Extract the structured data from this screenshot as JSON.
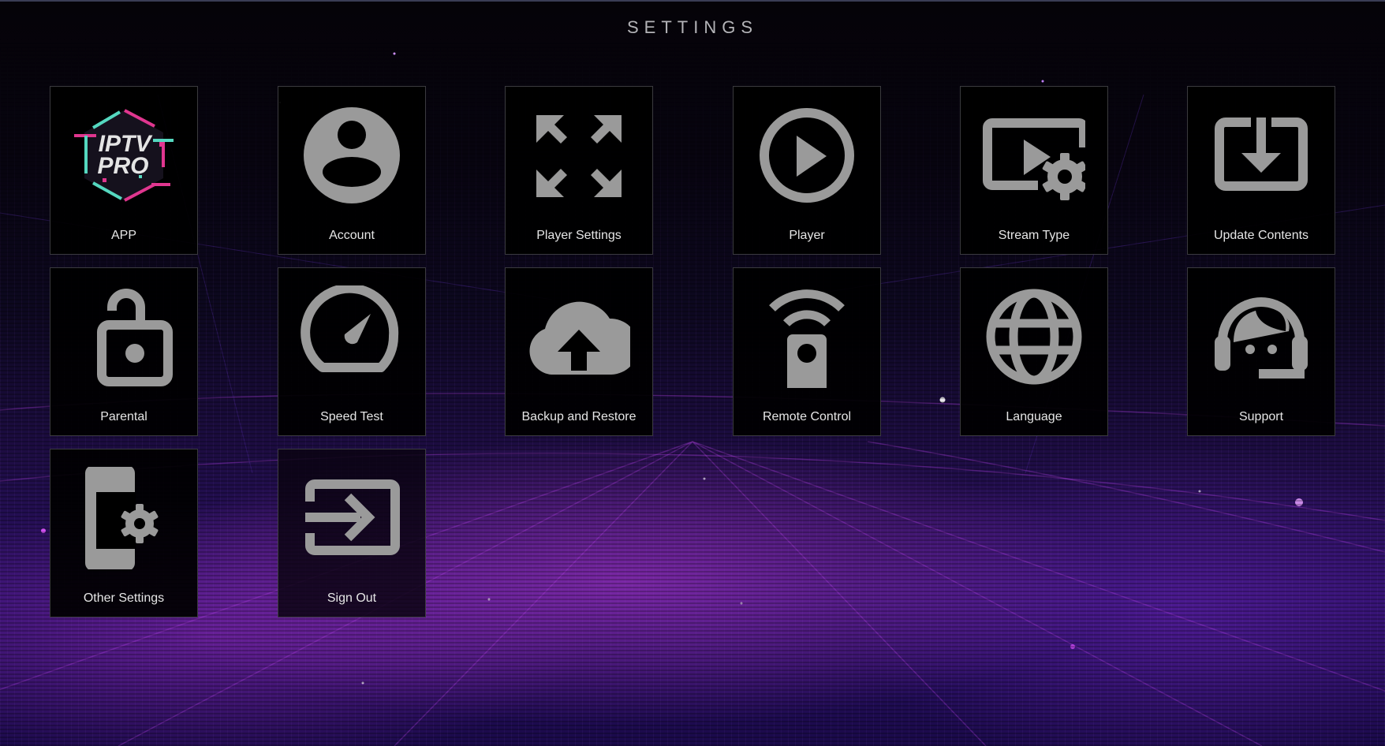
{
  "header": {
    "title": "SETTINGS"
  },
  "colors": {
    "icon": "#9a9a9a",
    "label": "#e6e6e6",
    "tile_bg": "#000000",
    "tile_border": "#3a3a3e",
    "accent_pink": "#e0368f",
    "accent_teal": "#55d8c0"
  },
  "tiles": [
    {
      "id": "app",
      "label": "APP",
      "icon": "iptv-pro-logo"
    },
    {
      "id": "account",
      "label": "Account",
      "icon": "account-circle-icon"
    },
    {
      "id": "player-settings",
      "label": "Player Settings",
      "icon": "fullscreen-arrows-icon"
    },
    {
      "id": "player",
      "label": "Player",
      "icon": "play-circle-icon"
    },
    {
      "id": "stream-type",
      "label": "Stream Type",
      "icon": "video-settings-icon"
    },
    {
      "id": "update-contents",
      "label": "Update Contents",
      "icon": "download-box-icon"
    },
    {
      "id": "parental",
      "label": "Parental",
      "icon": "lock-open-icon"
    },
    {
      "id": "speed-test",
      "label": "Speed Test",
      "icon": "speedometer-icon"
    },
    {
      "id": "backup-restore",
      "label": "Backup and Restore",
      "icon": "cloud-upload-icon"
    },
    {
      "id": "remote-control",
      "label": "Remote Control",
      "icon": "remote-control-icon"
    },
    {
      "id": "language",
      "label": "Language",
      "icon": "globe-icon"
    },
    {
      "id": "support",
      "label": "Support",
      "icon": "headset-support-icon"
    },
    {
      "id": "other-settings",
      "label": "Other Settings",
      "icon": "device-settings-icon"
    },
    {
      "id": "sign-out",
      "label": "Sign Out",
      "icon": "sign-out-icon"
    }
  ],
  "app_logo": {
    "line1": "IPTV",
    "line2": "PRO"
  }
}
